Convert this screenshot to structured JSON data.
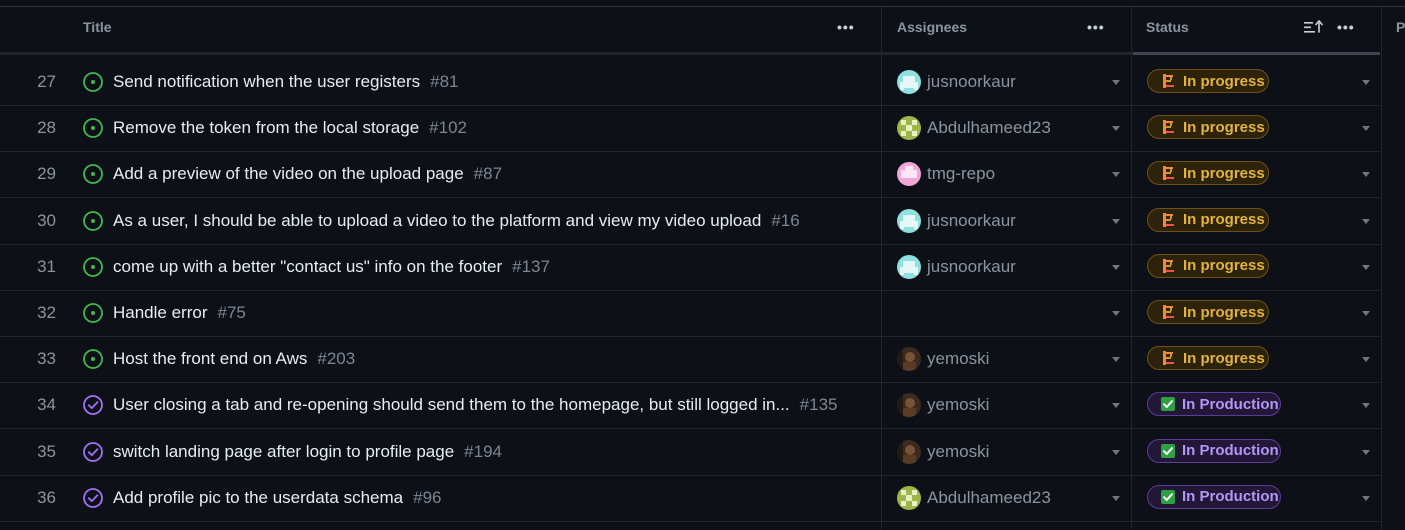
{
  "header": {
    "title_label": "Title",
    "assignees_label": "Assignees",
    "status_label": "Status",
    "more_menu_icon": "kebab-horizontal-icon",
    "sort_icon": "sort-ascending-icon",
    "partial_label": "P"
  },
  "status_options": {
    "in_progress": {
      "label": "In progress",
      "icon": "in-progress-icon",
      "color": "#e3b341"
    },
    "in_production": {
      "label": "In Production",
      "icon": "check-box-icon",
      "color": "#b496f8"
    }
  },
  "rows": [
    {
      "index": "27",
      "state": "open",
      "title": "Send notification when the user registers",
      "number": "#81",
      "assignee": "jusnoorkaur",
      "avatar": "teal",
      "status": "In progress"
    },
    {
      "index": "28",
      "state": "open",
      "title": "Remove the token from the local storage",
      "number": "#102",
      "assignee": "Abdulhameed23",
      "avatar": "olive",
      "status": "In progress"
    },
    {
      "index": "29",
      "state": "open",
      "title": "Add a preview of the video on the upload page",
      "number": "#87",
      "assignee": "tmg-repo",
      "avatar": "pink",
      "status": "In progress"
    },
    {
      "index": "30",
      "state": "open",
      "title": "As a user, I should be able to upload a video to the platform and view my video upload",
      "number": "#16",
      "assignee": "jusnoorkaur",
      "avatar": "teal",
      "status": "In progress"
    },
    {
      "index": "31",
      "state": "open",
      "title": "come up with a better \"contact us\" info on the footer",
      "number": "#137",
      "assignee": "jusnoorkaur",
      "avatar": "teal",
      "status": "In progress"
    },
    {
      "index": "32",
      "state": "open",
      "title": "Handle error",
      "number": "#75",
      "assignee": "",
      "avatar": "",
      "status": "In progress"
    },
    {
      "index": "33",
      "state": "open",
      "title": "Host the front end on Aws",
      "number": "#203",
      "assignee": "yemoski",
      "avatar": "photo",
      "status": "In progress"
    },
    {
      "index": "34",
      "state": "closed",
      "title": "User closing a tab and re-opening should send them to the homepage, but still logged in...",
      "number": "#135",
      "assignee": "yemoski",
      "avatar": "photo",
      "status": "In Production"
    },
    {
      "index": "35",
      "state": "closed",
      "title": "switch landing page after login to profile page",
      "number": "#194",
      "assignee": "yemoski",
      "avatar": "photo",
      "status": "In Production"
    },
    {
      "index": "36",
      "state": "closed",
      "title": "Add profile pic to the userdata schema",
      "number": "#96",
      "assignee": "Abdulhameed23",
      "avatar": "olive",
      "status": "In Production"
    }
  ],
  "colors": {
    "background": "#0d1117",
    "open_issue": "#3fb950",
    "closed_issue": "#a371f7",
    "border": "#21262d"
  }
}
